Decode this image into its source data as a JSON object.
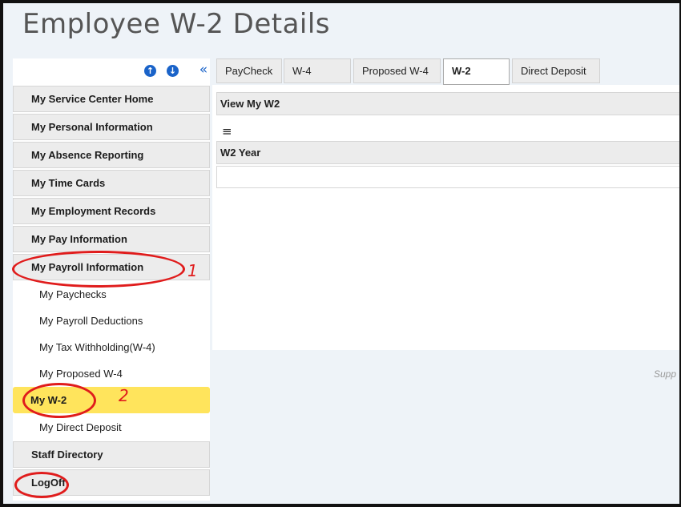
{
  "page": {
    "title": "Employee W-2 Details",
    "footer_text": "Supp"
  },
  "sidebar": {
    "tools": {
      "up_icon": "arrow-up-circle-icon",
      "down_icon": "arrow-down-circle-icon",
      "collapse_glyph": "«"
    },
    "items": [
      {
        "label": "My Service Center Home"
      },
      {
        "label": "My Personal Information"
      },
      {
        "label": "My Absence Reporting"
      },
      {
        "label": "My Time Cards"
      },
      {
        "label": "My Employment Records"
      },
      {
        "label": "My Pay Information"
      },
      {
        "label": "My Payroll Information"
      },
      {
        "label": "Staff Directory"
      },
      {
        "label": "LogOff"
      }
    ],
    "subitems": [
      {
        "label": "My Paychecks"
      },
      {
        "label": "My Payroll Deductions"
      },
      {
        "label": "My Tax Withholding(W-4)"
      },
      {
        "label": "My Proposed W-4"
      },
      {
        "label": "My W-2",
        "active": true
      },
      {
        "label": "My Direct Deposit"
      }
    ]
  },
  "tabs": [
    {
      "label": "PayCheck"
    },
    {
      "label": "W-4"
    },
    {
      "label": "Proposed W-4"
    },
    {
      "label": "W-2",
      "active": true
    },
    {
      "label": "Direct Deposit"
    }
  ],
  "content": {
    "section_title": "View My W2",
    "menu_glyph": "≡",
    "column_header": "W2 Year"
  },
  "annotations": {
    "one": "1",
    "two": "2",
    "color": "#e01c1c"
  },
  "colors": {
    "accent": "#1a63c9",
    "active_highlight": "#ffe45c"
  }
}
